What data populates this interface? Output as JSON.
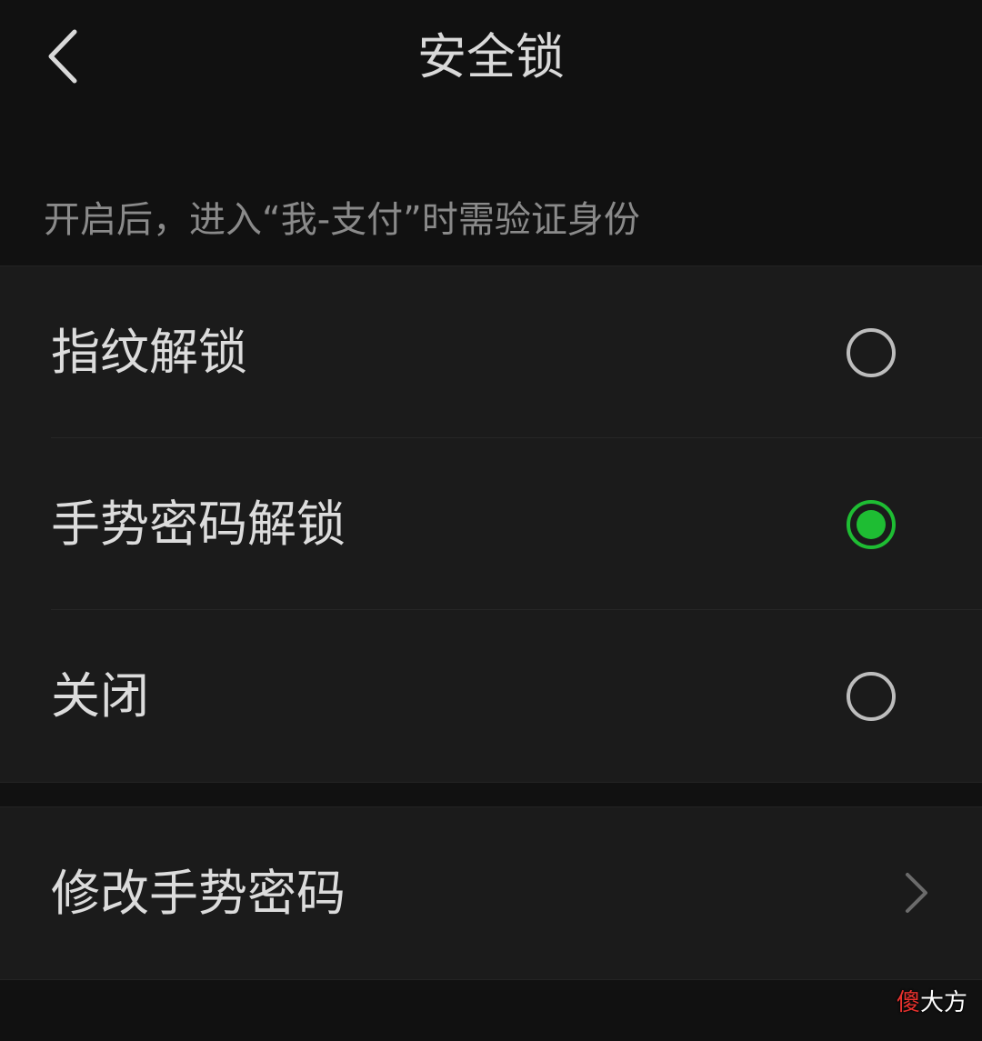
{
  "header": {
    "title": "安全锁",
    "back_icon": "chevron-left-icon"
  },
  "hint": "开启后，进入“我-支付”时需验证身份",
  "options": [
    {
      "label": "指纹解锁",
      "selected": false
    },
    {
      "label": "手势密码解锁",
      "selected": true
    },
    {
      "label": "关闭",
      "selected": false
    }
  ],
  "change_gesture": {
    "label": "修改手势密码",
    "icon": "chevron-right-icon"
  },
  "watermark": {
    "accent": "傻",
    "rest": "大方"
  },
  "colors": {
    "background": "#111111",
    "card": "#1b1b1b",
    "accent_green": "#1ebd33",
    "hint_text": "#8a8a8a"
  }
}
